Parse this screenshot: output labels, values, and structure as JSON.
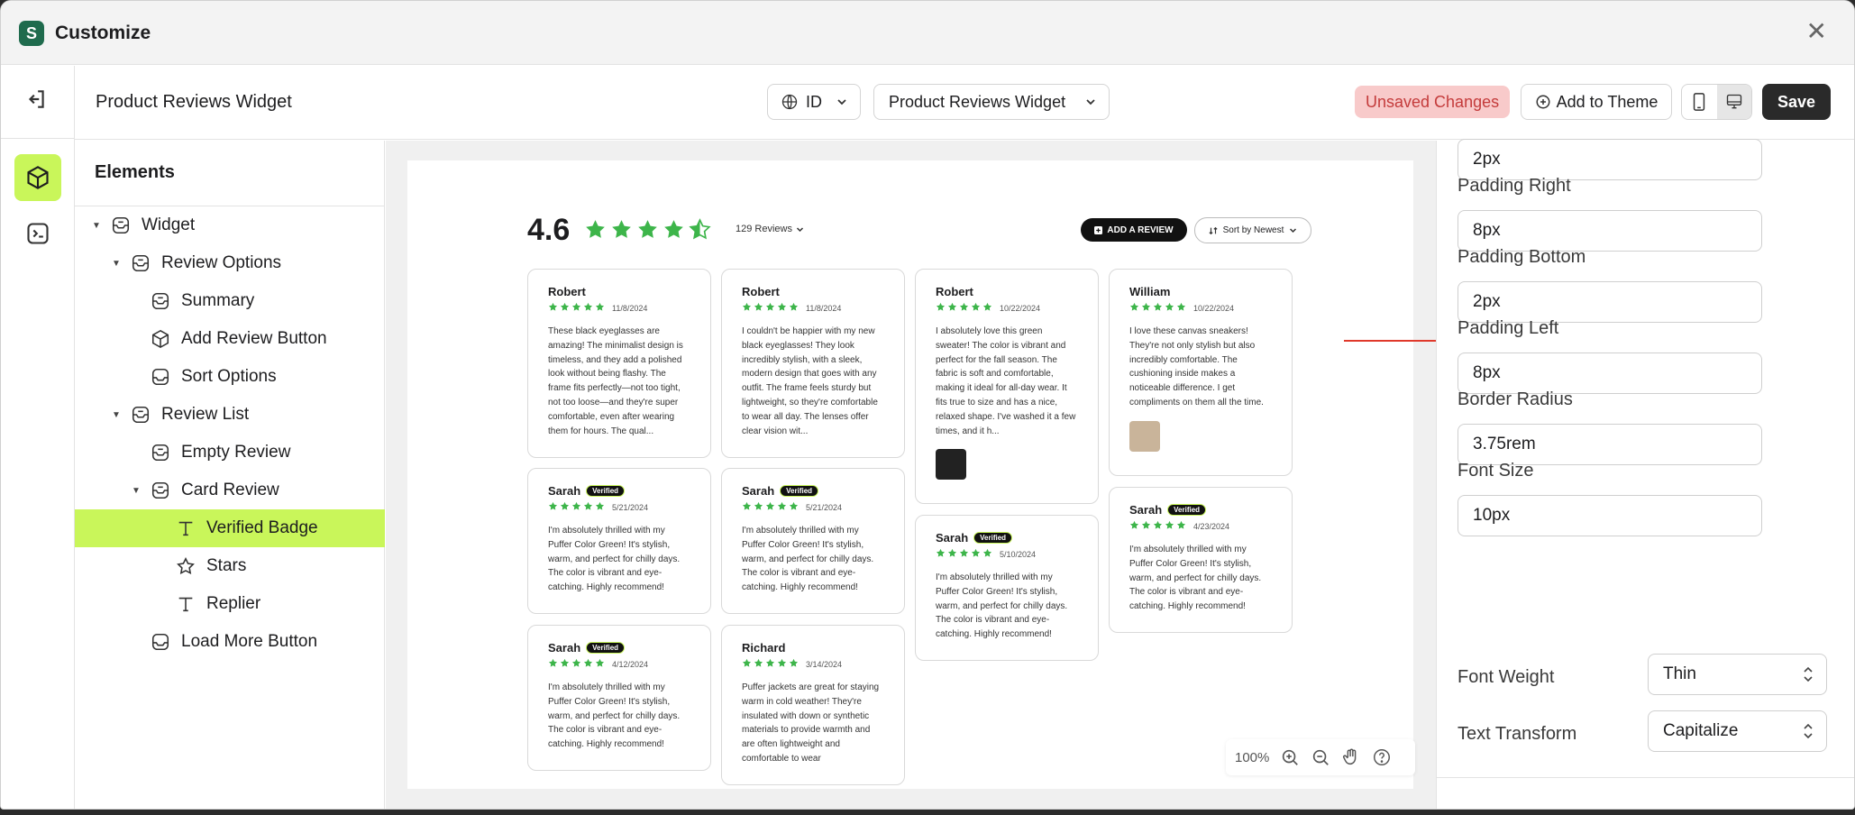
{
  "app": {
    "title": "Customize"
  },
  "header": {
    "page_title": "Product Reviews Widget",
    "language": "ID",
    "widget_select": "Product Reviews Widget",
    "unsaved": "Unsaved Changes",
    "add_to_theme": "Add to Theme",
    "save": "Save"
  },
  "tree": {
    "title": "Elements",
    "items": [
      {
        "label": "Widget",
        "level": 0,
        "caret": true,
        "icon": "widget-icon"
      },
      {
        "label": "Review Options",
        "level": 1,
        "caret": true,
        "icon": "widget-icon"
      },
      {
        "label": "Summary",
        "level": 2,
        "caret": false,
        "icon": "widget-icon"
      },
      {
        "label": "Add Review Button",
        "level": 2,
        "caret": false,
        "icon": "cube-icon"
      },
      {
        "label": "Sort Options",
        "level": 2,
        "caret": false,
        "icon": "container-icon"
      },
      {
        "label": "Review List",
        "level": 1,
        "caret": true,
        "icon": "widget-icon"
      },
      {
        "label": "Empty Review",
        "level": 2,
        "caret": false,
        "icon": "widget-icon"
      },
      {
        "label": "Card Review",
        "level": 2,
        "caret": true,
        "icon": "widget-icon"
      },
      {
        "label": "Verified Badge",
        "level": 3,
        "caret": false,
        "icon": "text-icon",
        "selected": true
      },
      {
        "label": "Stars",
        "level": 3,
        "caret": false,
        "icon": "star-icon"
      },
      {
        "label": "Replier",
        "level": 3,
        "caret": false,
        "icon": "text-icon"
      },
      {
        "label": "Load More Button",
        "level": 2,
        "caret": false,
        "icon": "container-icon"
      }
    ]
  },
  "preview": {
    "rating": "4.6",
    "review_count": "129 Reviews",
    "add_review": "ADD A REVIEW",
    "sort": "Sort by Newest",
    "star_color": "#3db54a",
    "cards": [
      {
        "name": "Robert",
        "date": "11/8/2024",
        "verified": false,
        "text": "These black eyeglasses are amazing! The minimalist design is timeless, and they add a polished look without being flashy. The frame fits perfectly—not too tight, not too loose—and they're super comfortable, even after wearing them for hours. The qual...",
        "thumb": false
      },
      {
        "name": "Sarah",
        "date": "5/21/2024",
        "verified": true,
        "text": "I'm absolutely thrilled with my Puffer Color Green! It's stylish, warm, and perfect for chilly days. The color is vibrant and eye-catching. Highly recommend!",
        "thumb": false
      },
      {
        "name": "Sarah",
        "date": "4/12/2024",
        "verified": true,
        "text": "I'm absolutely thrilled with my Puffer Color Green! It's stylish, warm, and perfect for chilly days. The color is vibrant and eye-catching. Highly recommend!",
        "thumb": false
      },
      {
        "name": "Robert",
        "date": "11/8/2024",
        "verified": false,
        "text": "I couldn't be happier with my new black eyeglasses! They look incredibly stylish, with a sleek, modern design that goes with any outfit. The frame feels sturdy but lightweight, so they're comfortable to wear all day. The lenses offer clear vision wit...",
        "thumb": false
      },
      {
        "name": "Sarah",
        "date": "5/21/2024",
        "verified": true,
        "text": "I'm absolutely thrilled with my Puffer Color Green! It's stylish, warm, and perfect for chilly days. The color is vibrant and eye-catching. Highly recommend!",
        "thumb": false
      },
      {
        "name": "Richard",
        "date": "3/14/2024",
        "verified": false,
        "text": "Puffer jackets are great for staying warm in cold weather! They're insulated with down or synthetic materials to provide warmth and are often lightweight and comfortable to wear",
        "thumb": false
      },
      {
        "name": "Robert",
        "date": "10/22/2024",
        "verified": false,
        "text": "I absolutely love this green sweater! The color is vibrant and perfect for the fall season. The fabric is soft and comfortable, making it ideal for all-day wear. It fits true to size and has a nice, relaxed shape. I've washed it a few times, and it h...",
        "thumb": true,
        "thumb_color": "#222222"
      },
      {
        "name": "Sarah",
        "date": "5/10/2024",
        "verified": true,
        "text": "I'm absolutely thrilled with my Puffer Color Green! It's stylish, warm, and perfect for chilly days. The color is vibrant and eye-catching. Highly recommend!",
        "thumb": false
      },
      {
        "name": "William",
        "date": "10/22/2024",
        "verified": false,
        "text": "I love these canvas sneakers! They're not only stylish but also incredibly comfortable. The cushioning inside makes a noticeable difference. I get compliments on them all the time.",
        "thumb": true,
        "thumb_color": "#c9b49a"
      },
      {
        "name": "Sarah",
        "date": "4/23/2024",
        "verified": true,
        "text": "I'm absolutely thrilled with my Puffer Color Green! It's stylish, warm, and perfect for chilly days. The color is vibrant and eye-catching. Highly recommend!",
        "thumb": false
      }
    ],
    "verified_label": "Verified",
    "zoom": "100%"
  },
  "props": {
    "fields": [
      {
        "label": "",
        "value": "2px"
      },
      {
        "label": "Padding Right",
        "value": "8px"
      },
      {
        "label": "Padding Bottom",
        "value": "2px"
      },
      {
        "label": "Padding Left",
        "value": "8px"
      },
      {
        "label": "Border Radius",
        "value": "3.75rem"
      },
      {
        "label": "Font Size",
        "value": "10px"
      }
    ],
    "font_weight_label": "Font Weight",
    "font_weight": "Thin",
    "text_transform_label": "Text Transform",
    "text_transform": "Capitalize"
  }
}
